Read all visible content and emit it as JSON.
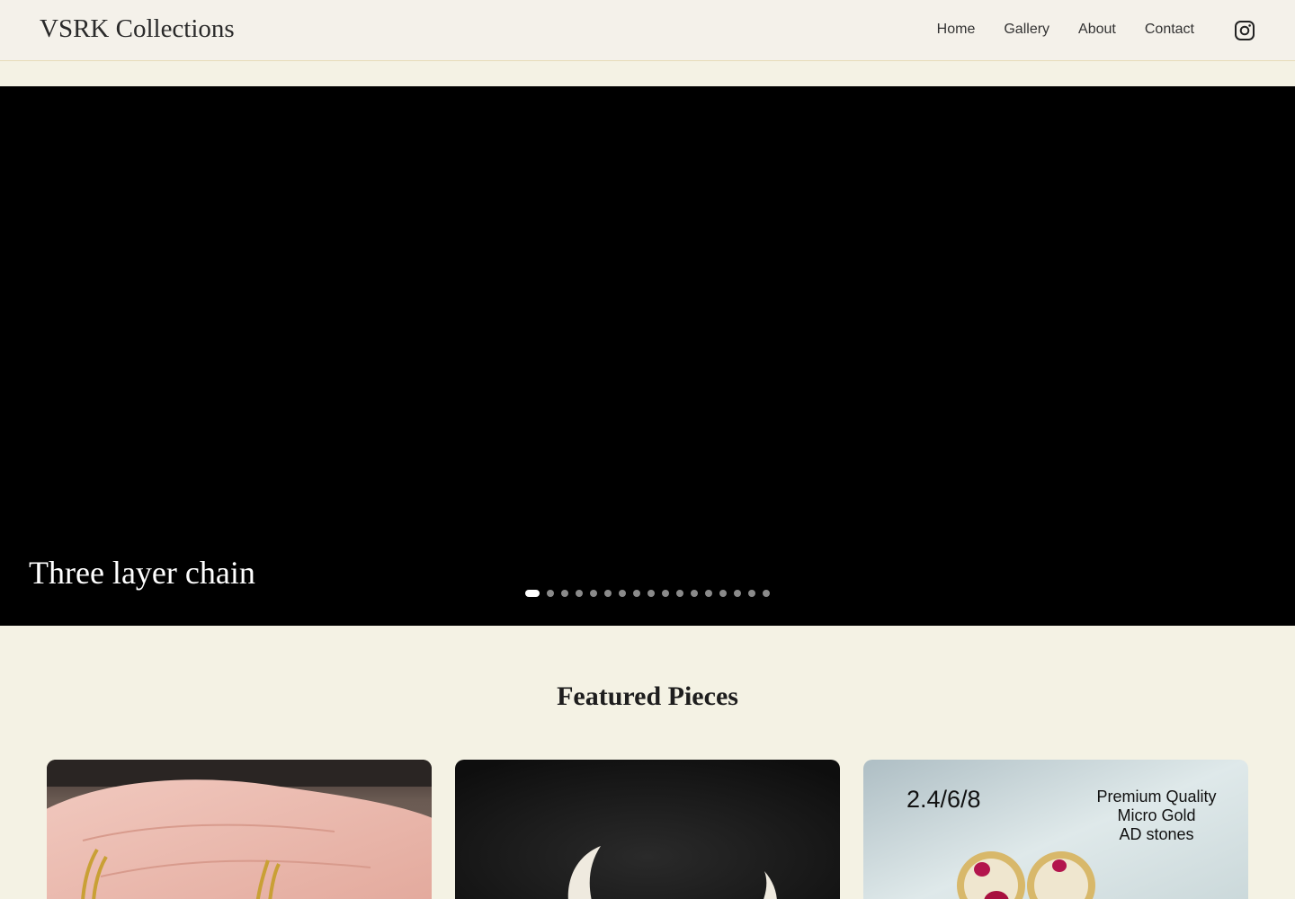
{
  "header": {
    "brand": "VSRK Collections",
    "nav": [
      "Home",
      "Gallery",
      "About",
      "Contact"
    ],
    "social_icon": "instagram-icon"
  },
  "hero": {
    "caption": "Three layer chain",
    "slide_count": 17,
    "active_slide": 1
  },
  "featured": {
    "title": "Featured Pieces",
    "cards": [
      {
        "image": "gold-chain-in-hand"
      },
      {
        "image": "white-pendant-on-black"
      },
      {
        "image": "ruby-ad-earrings",
        "overlay_left": "2.4/6/8",
        "overlay_right": [
          "Premium Quality",
          "Micro Gold",
          "AD stones"
        ]
      }
    ]
  },
  "colors": {
    "header_bg": "#f4f1ea",
    "page_bg": "#f4f2e4",
    "hero_bg": "#000000",
    "active_dot": "#ffffff",
    "inactive_dot": "#8a8a8a"
  }
}
